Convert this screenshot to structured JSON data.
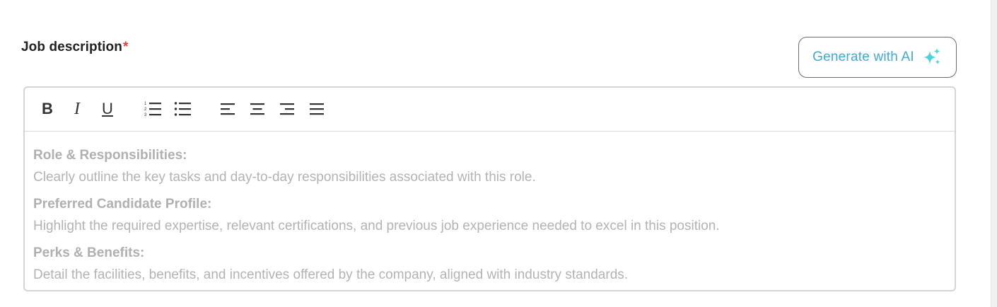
{
  "field": {
    "label": "Job description",
    "required_marker": "*"
  },
  "ai_button": {
    "label": "Generate with AI",
    "icon": "sparkle-icon",
    "accent_color": "#3fa9d9"
  },
  "toolbar": {
    "bold": "B",
    "italic": "I",
    "underline": "U",
    "buttons": [
      "bold",
      "italic",
      "underline",
      "ordered-list",
      "bullet-list",
      "align-left",
      "align-center",
      "align-right",
      "align-justify"
    ]
  },
  "placeholder": {
    "sections": [
      {
        "heading": "Role & Responsibilities:",
        "body": "Clearly outline the key tasks and day-to-day responsibilities associated with this role."
      },
      {
        "heading": "Preferred Candidate Profile:",
        "body": "Highlight the required expertise, relevant certifications, and previous job experience needed to excel in this position."
      },
      {
        "heading": "Perks & Benefits:",
        "body": "Detail the facilities, benefits, and incentives offered by the company, aligned with industry standards."
      }
    ]
  }
}
